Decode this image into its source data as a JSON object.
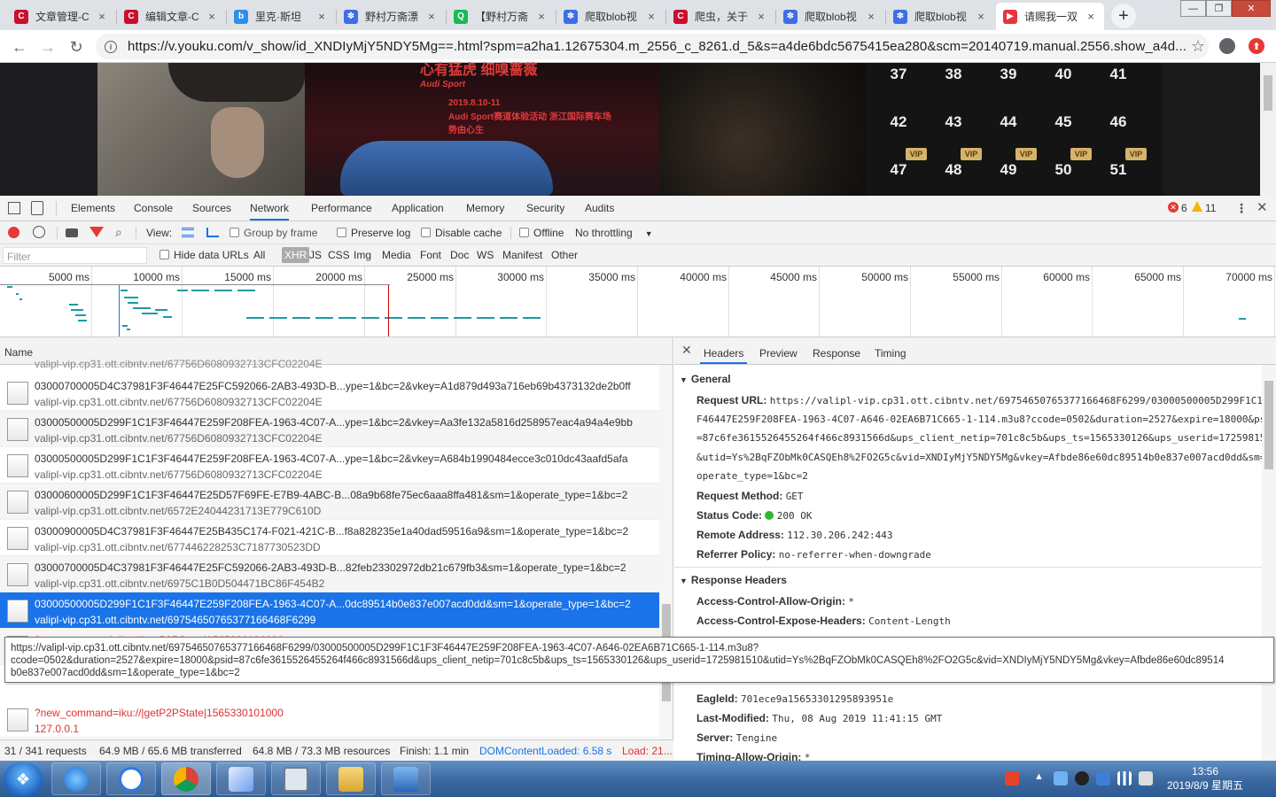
{
  "browser": {
    "tabs": [
      {
        "title": "文章管理-C",
        "icon": "csdn-icon",
        "color": "#c8102e",
        "glyph": "C"
      },
      {
        "title": "编辑文章-C",
        "icon": "csdn-icon",
        "color": "#c8102e",
        "glyph": "C"
      },
      {
        "title": "里克·斯坦",
        "icon": "bilibili-icon",
        "color": "#2f8fe8",
        "glyph": "b"
      },
      {
        "title": "野村万斋漂",
        "icon": "baidu-paw-icon",
        "color": "#3b6ee8",
        "glyph": "✽"
      },
      {
        "title": "【野村万斋",
        "icon": "iqiyi-icon",
        "color": "#19b955",
        "glyph": "Q"
      },
      {
        "title": "爬取blob视",
        "icon": "baidu-paw-icon",
        "color": "#3b6ee8",
        "glyph": "✽"
      },
      {
        "title": "爬虫，关于",
        "icon": "csdn-icon",
        "color": "#c8102e",
        "glyph": "C"
      },
      {
        "title": "爬取blob视",
        "icon": "baidu-paw-icon",
        "color": "#3b6ee8",
        "glyph": "✽"
      },
      {
        "title": "爬取blob视",
        "icon": "baidu-paw-icon",
        "color": "#3b6ee8",
        "glyph": "✽"
      },
      {
        "title": "请赐我一双",
        "icon": "youku-icon",
        "color": "#e8343d",
        "glyph": "▶",
        "active": true
      }
    ],
    "close_glyph": "×",
    "new_tab_glyph": "+",
    "url": "https://v.youku.com/v_show/id_XNDIyMjY5NDY5Mg==.html?spm=a2ha1.12675304.m_2556_c_8261.d_5&s=a4de6bdc5675415ea280&scm=20140719.manual.2556.show_a4d...",
    "back_glyph": "←",
    "forward_glyph": "→",
    "reload_glyph": "↻",
    "star_glyph": "☆",
    "window": {
      "minimize": "—",
      "maximize": "❐",
      "close": "✕"
    }
  },
  "page": {
    "ad_lines": [
      "心有猛虎 细嗅蔷薇",
      "Audi Sport",
      "2019.8.10-11",
      "Audi Sport赛道体验活动 浙江国际赛车场",
      "势由心生"
    ],
    "episodes_row1": [
      "37",
      "38",
      "39",
      "40",
      "41"
    ],
    "episodes_row2": [
      "42",
      "43",
      "44",
      "45",
      "46"
    ],
    "episodes_row3": [
      "47",
      "48",
      "49",
      "50",
      "51"
    ],
    "vip_label": "VIP"
  },
  "devtools": {
    "tabs": [
      "Elements",
      "Console",
      "Sources",
      "Network",
      "Performance",
      "Application",
      "Memory",
      "Security",
      "Audits"
    ],
    "active_tab": "Network",
    "errors": "6",
    "warnings": "11",
    "view_label": "View:",
    "group_by_frame": "Group by frame",
    "preserve_log": "Preserve log",
    "disable_cache": "Disable cache",
    "offline": "Offline",
    "throttling": "No throttling",
    "filter_placeholder": "Filter",
    "hide_data_urls": "Hide data URLs",
    "types": [
      "All",
      "XHR",
      "JS",
      "CSS",
      "Img",
      "Media",
      "Font",
      "Doc",
      "WS",
      "Manifest",
      "Other"
    ],
    "active_type": "XHR",
    "timeline_ticks": [
      "5000 ms",
      "10000 ms",
      "15000 ms",
      "20000 ms",
      "25000 ms",
      "30000 ms",
      "35000 ms",
      "40000 ms",
      "45000 ms",
      "50000 ms",
      "55000 ms",
      "60000 ms",
      "65000 ms",
      "70000 ms"
    ],
    "name_header": "Name",
    "requests": [
      {
        "name": "03000700005D4C37981F3F46447E25FC592066-2AB3-493D-B...ype=1&bc=2&vkey=A1d879d493a716eb69b4373132de2b0ff",
        "host": "valipl-vip.cp31.ott.cibntv.net/67756D6080932713CFC02204E"
      },
      {
        "name": "03000500005D299F1C1F3F46447E259F208FEA-1963-4C07-A...ype=1&bc=2&vkey=Aa3fe132a5816d258957eac4a94a4e9bb",
        "host": "valipl-vip.cp31.ott.cibntv.net/67756D6080932713CFC02204E"
      },
      {
        "name": "03000500005D299F1C1F3F46447E259F208FEA-1963-4C07-A...ype=1&bc=2&vkey=A684b1990484ecce3c010dc43aafd5afa",
        "host": "valipl-vip.cp31.ott.cibntv.net/67756D6080932713CFC02204E"
      },
      {
        "name": "03000600005D299F1C1F3F46447E25D57F69FE-E7B9-4ABC-B...08a9b68fe75ec6aaa8ffa481&sm=1&operate_type=1&bc=2",
        "host": "valipl-vip.cp31.ott.cibntv.net/6572E24044231713E779C610D"
      },
      {
        "name": "03000900005D4C37981F3F46447E25B435C174-F021-421C-B...f8a828235e1a40dad59516a9&sm=1&operate_type=1&bc=2",
        "host": "valipl-vip.cp31.ott.cibntv.net/677446228253C7187730523DD"
      },
      {
        "name": "03000700005D4C37981F3F46447E25FC592066-2AB3-493D-B...82feb23302972db21c679fb3&sm=1&operate_type=1&bc=2",
        "host": "valipl-vip.cp31.ott.cibntv.net/6975C1B0D504471BC86F454B2"
      },
      {
        "name": "03000500005D299F1C1F3F46447E259F208FEA-1963-4C07-A...0dc89514b0e837e007acd0dd&sm=1&operate_type=1&bc=2",
        "host": "valipl-vip.cp31.ott.cibntv.net/69754650765377166468F6299",
        "selected": true
      },
      {
        "name": "?new_command=iku://|getP2PState|1565330101000",
        "host": "127.0.0.1",
        "error": true
      },
      {
        "name": "?new_command=iku://|getP2PState|1565330101000",
        "host": "127.0.0.1",
        "error": true
      }
    ],
    "partial_top_host": "valipl-vip.cp31.ott.cibntv.net/67756D6080932713CFC02204E",
    "tooltip": [
      "https://valipl-vip.cp31.ott.cibntv.net/69754650765377166468F6299/03000500005D299F1C1F3F46447E259F208FEA-1963-4C07-A646-02EA6B71C665-1-114.m3u8?",
      "ccode=0502&duration=2527&expire=18000&psid=87c6fe3615526455264f466c8931566d&ups_client_netip=701c8c5b&ups_ts=1565330126&ups_userid=1725981510&utid=Ys%2BqFZObMk0CASQEh8%2FO2G5c&vid=XNDIyMjY5NDY5Mg&vkey=Afbde86e60dc89514",
      "b0e837e007acd0dd&sm=1&operate_type=1&bc=2"
    ],
    "status": {
      "requests": "31 / 341 requests",
      "transferred": "64.9 MB / 65.6 MB transferred",
      "resources": "64.8 MB / 73.3 MB resources",
      "finish": "Finish: 1.1 min",
      "dcl": "DOMContentLoaded: 6.58 s",
      "load": "Load: 21...."
    },
    "detail_tabs": [
      "Headers",
      "Preview",
      "Response",
      "Timing"
    ],
    "active_detail_tab": "Headers",
    "general_title": "General",
    "request_url_label": "Request URL:",
    "request_url_lines": [
      "https://valipl-vip.cp31.ott.cibntv.net/69754650765377166468F6299/03000500005D299F1C1F3",
      "F46447E259F208FEA-1963-4C07-A646-02EA6B71C665-1-114.m3u8?ccode=0502&duration=2527&expire=18000&ps",
      "=87c6fe3615526455264f466c8931566d&ups_client_netip=701c8c5b&ups_ts=1565330126&ups_userid=17259815",
      "&utid=Ys%2BqFZObMk0CASQEh8%2FO2G5c&vid=XNDIyMjY5NDY5Mg&vkey=Afbde86e60dc89514b0e837e007acd0dd&sm=",
      "operate_type=1&bc=2"
    ],
    "request_method_label": "Request Method:",
    "request_method": "GET",
    "status_code_label": "Status Code:",
    "status_code": "200  OK",
    "remote_address_label": "Remote Address:",
    "remote_address": "112.30.206.242:443",
    "referrer_policy_label": "Referrer Policy:",
    "referrer_policy": "no-referrer-when-downgrade",
    "response_headers_title": "Response Headers",
    "acao_label": "Access-Control-Allow-Origin:",
    "acao": "*",
    "aceh_label": "Access-Control-Expose-Headers:",
    "aceh": "Content-Length",
    "eagleid_label": "EagleId:",
    "eagleid": "701ece9a15653301295893951e",
    "last_modified_label": "Last-Modified:",
    "last_modified": "Thu, 08 Aug 2019 11:41:15 GMT",
    "server_label": "Server:",
    "server": "Tengine",
    "tao_label": "Timing-Allow-Origin:",
    "tao": "*"
  },
  "taskbar": {
    "time": "13:56",
    "date": "2019/8/9 星期五",
    "start_glyph": "❖"
  },
  "colors": {
    "accent": "#1a73e8",
    "status_ok": "#2eb82e",
    "error": "#e03030",
    "waterfall": "#1a9ba8"
  }
}
